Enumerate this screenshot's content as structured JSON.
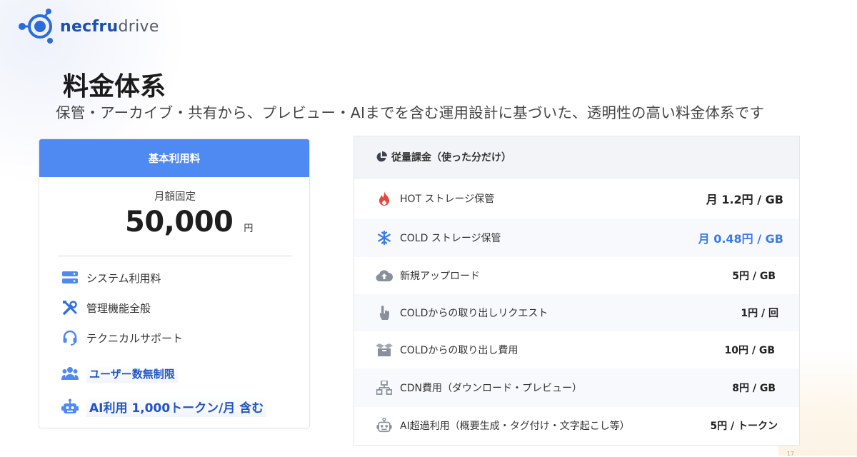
{
  "brand": {
    "name_a": "necfru",
    "name_b": "drive"
  },
  "page": {
    "title": "料金体系",
    "subtitle": "保管・アーカイブ・共有から、プレビュー・AIまでを含む運用設計に基づいた、透明性の高い料金体系です",
    "page_number": "17"
  },
  "base": {
    "header": "基本利用料",
    "fixed_label": "月額固定",
    "price": "50,000",
    "unit": "円",
    "features": [
      {
        "icon": "server-icon",
        "label": "システム利用料"
      },
      {
        "icon": "tools-icon",
        "label": "管理機能全般"
      },
      {
        "icon": "headset-icon",
        "label": "テクニカルサポート"
      }
    ],
    "highlights": [
      {
        "icon": "users-icon",
        "label": "ユーザー数無制限"
      },
      {
        "icon": "robot-icon",
        "label": "AI利用 1,000トークン/月 含む"
      }
    ]
  },
  "usage": {
    "header": "従量課金（使った分だけ）",
    "header_icon": "pie-chart-icon",
    "rows": [
      {
        "icon": "fire-icon",
        "label": "HOT ストレージ保管",
        "value": "月 1.2円 / GB"
      },
      {
        "icon": "snowflake-icon",
        "label": "COLD ストレージ保管",
        "value": "月 0.48円 / GB"
      },
      {
        "icon": "cloud-upload-icon",
        "label": "新規アップロード",
        "value": "5円 / GB"
      },
      {
        "icon": "hand-pointer-icon",
        "label": "COLDからの取り出しリクエスト",
        "value": "1円 / 回"
      },
      {
        "icon": "box-open-icon",
        "label": "COLDからの取り出し費用",
        "value": "10円 / GB"
      },
      {
        "icon": "network-icon",
        "label": "CDN費用（ダウンロード・プレビュー）",
        "value": "8円 / GB"
      },
      {
        "icon": "robot-icon",
        "label": "AI超過利用（概要生成・タグ付け・文字起こし等）",
        "value": "5円 / トークン"
      }
    ]
  },
  "colors": {
    "accent": "#4f8af3",
    "highlight_text": "#2155c7",
    "cold_value": "#3b7be6",
    "fire": "#e8453c"
  }
}
